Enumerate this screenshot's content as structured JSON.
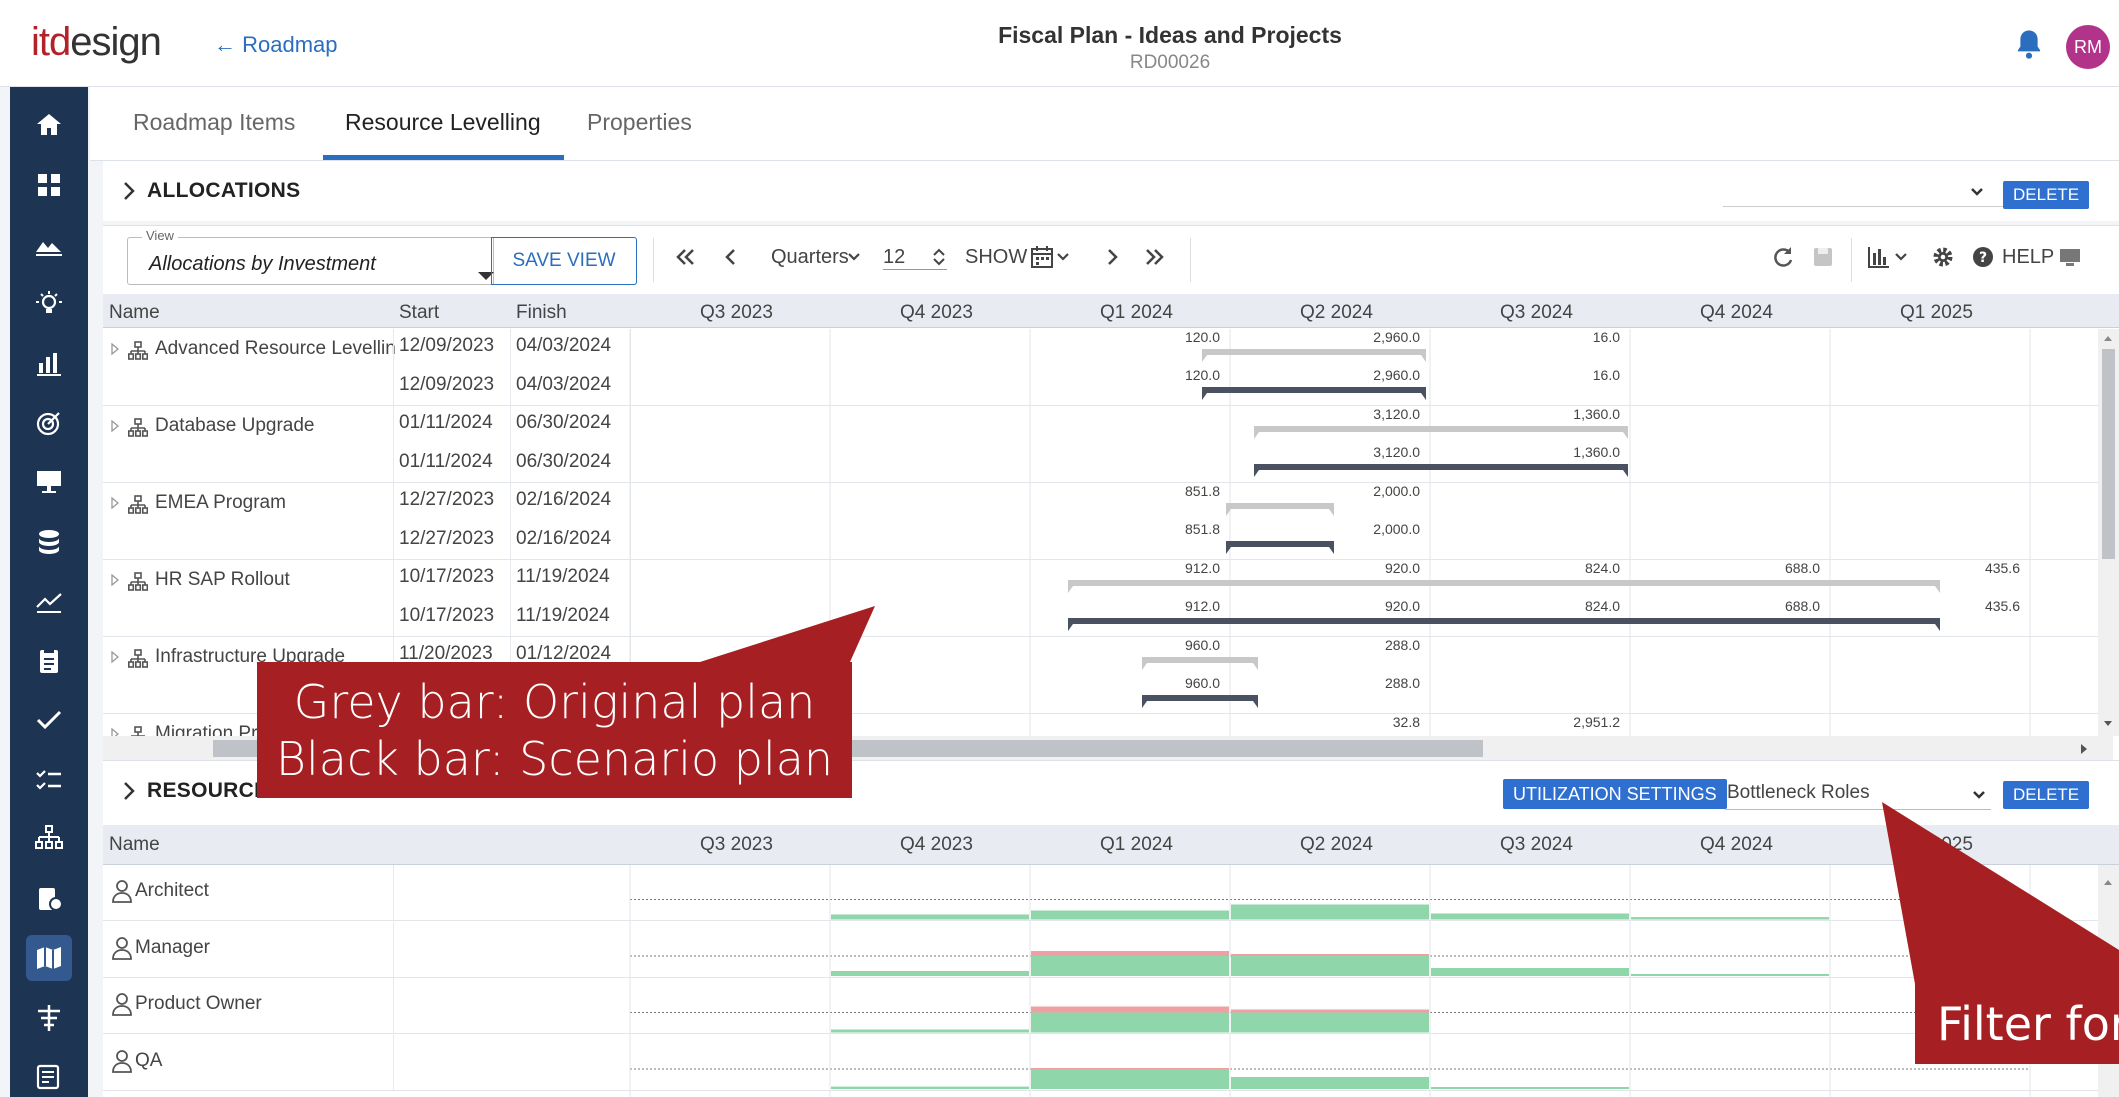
{
  "header": {
    "logo_part1": "itd",
    "logo_part2": "esign",
    "back_label": "← Roadmap",
    "title": "Fiscal Plan - Ideas and Projects",
    "subtitle": "RD00026",
    "avatar_initials": "RM",
    "accent": "#2a6ebd",
    "avatar_color": "#b1338a"
  },
  "sidebar": {
    "icons": [
      "home-icon",
      "dashboard-icon",
      "landscape-icon",
      "idea-bulb-icon",
      "bar-chart-icon",
      "target-icon",
      "presentation-icon",
      "database-icon",
      "trend-icon",
      "clipboard-icon",
      "check-icon",
      "checklist-icon",
      "hierarchy-icon",
      "bug-report-icon",
      "roadmap-icon",
      "filter-icon",
      "report-icon"
    ],
    "active_index": 14
  },
  "tabs": [
    {
      "label": "Roadmap Items",
      "active": false
    },
    {
      "label": "Resource Levelling",
      "active": true
    },
    {
      "label": "Properties",
      "active": false
    }
  ],
  "allocations": {
    "section_title": "ALLOCATIONS",
    "delete_label": "DELETE",
    "view_label": "View",
    "view_value": "Allocations by Investment",
    "save_view_label": "SAVE VIEW",
    "period_label": "Quarters",
    "period_count": "12",
    "show_label": "SHOW",
    "help_label": "HELP",
    "columns": {
      "name": "Name",
      "start": "Start",
      "finish": "Finish"
    },
    "quarters": [
      "Q3 2023",
      "Q4 2023",
      "Q1 2024",
      "Q2 2024",
      "Q3 2024",
      "Q4 2024",
      "Q1 2025"
    ],
    "projects": [
      {
        "name": "Advanced Resource Levelling",
        "start": "12/09/2023",
        "finish": "04/03/2024",
        "start2": "12/09/2023",
        "finish2": "04/03/2024",
        "bar_from": 3.86,
        "bar_to": 4.98,
        "labels": [
          {
            "q": 3,
            "v": "120.0"
          },
          {
            "q": 4,
            "v": "2,960.0"
          },
          {
            "q": 5,
            "v": "16.0"
          }
        ]
      },
      {
        "name": "Database Upgrade",
        "start": "01/11/2024",
        "finish": "06/30/2024",
        "start2": "01/11/2024",
        "finish2": "06/30/2024",
        "bar_from": 4.12,
        "bar_to": 5.99,
        "labels": [
          {
            "q": 4,
            "v": "3,120.0"
          },
          {
            "q": 5,
            "v": "1,360.0"
          }
        ]
      },
      {
        "name": "EMEA Program",
        "start": "12/27/2023",
        "finish": "02/16/2024",
        "start2": "12/27/2023",
        "finish2": "02/16/2024",
        "bar_from": 3.98,
        "bar_to": 4.52,
        "labels": [
          {
            "q": 3,
            "v": "851.8"
          },
          {
            "q": 4,
            "v": "2,000.0"
          }
        ]
      },
      {
        "name": "HR SAP Rollout",
        "start": "10/17/2023",
        "finish": "11/19/2024",
        "start2": "10/17/2023",
        "finish2": "11/19/2024",
        "bar_from": 3.19,
        "bar_to": 7.55,
        "labels": [
          {
            "q": 3,
            "v": "912.0"
          },
          {
            "q": 4,
            "v": "920.0"
          },
          {
            "q": 5,
            "v": "824.0"
          },
          {
            "q": 6,
            "v": "688.0"
          },
          {
            "q": 7,
            "v": "435.6"
          }
        ]
      },
      {
        "name": "Infrastructure Upgrade",
        "start": "11/20/2023",
        "finish": "01/12/2024",
        "start2": "",
        "finish2": "",
        "bar_from": 3.56,
        "bar_to": 4.14,
        "labels": [
          {
            "q": 3,
            "v": "960.0"
          },
          {
            "q": 4,
            "v": "288.0"
          }
        ]
      },
      {
        "name": "Migration Project",
        "start": "",
        "finish": "",
        "start2": "",
        "finish2": "",
        "bar_from": 0,
        "bar_to": 0,
        "labels": [
          {
            "q": 4,
            "v": "32.8"
          },
          {
            "q": 5,
            "v": "2,951.2"
          }
        ]
      }
    ]
  },
  "resources": {
    "section_title": "RESOURCES",
    "utilization_label": "UTILIZATION SETTINGS",
    "filter_value": "Bottleneck Roles",
    "delete_label": "DELETE",
    "name_header": "Name",
    "quarters": [
      "Q3 2023",
      "Q4 2023",
      "Q1 2024",
      "Q2 2024",
      "Q3 2024",
      "Q4 2024",
      "Q1 2025"
    ],
    "rows": [
      {
        "name": "Architect",
        "util": [
          0,
          0.25,
          0.45,
          0.75,
          0.3,
          0.12,
          0
        ]
      },
      {
        "name": "Manager",
        "util": [
          0,
          0.25,
          1.25,
          1.1,
          0.4,
          0.1,
          0
        ]
      },
      {
        "name": "Product Owner",
        "util": [
          0,
          0.15,
          1.3,
          1.15,
          0,
          0,
          0
        ]
      },
      {
        "name": "QA",
        "util": [
          0,
          0.12,
          1.05,
          0.6,
          0.1,
          0,
          0
        ]
      }
    ]
  },
  "annotations": {
    "line1": "Grey bar: Original plan",
    "line2": "Black bar: Scenario plan",
    "filter_note": "Filter for"
  },
  "colors": {
    "original_bar": "#c8c8c8",
    "scenario_bar": "#4a5160",
    "util_ok": "#8fd6ab",
    "util_over": "#f0a0a2",
    "callout": "#a61f22"
  }
}
